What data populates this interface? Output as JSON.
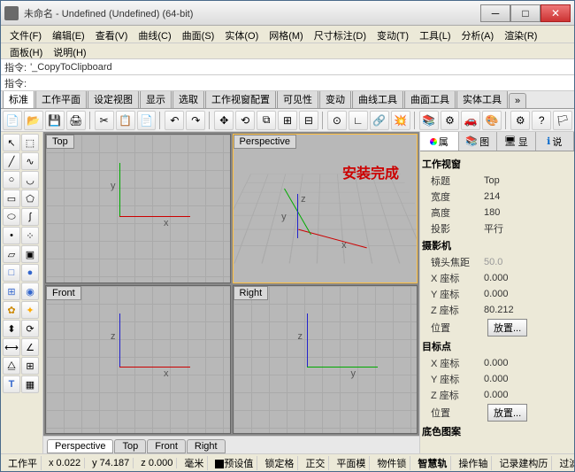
{
  "window": {
    "title": "未命名 - Undefined (Undefined) (64-bit)"
  },
  "menus": {
    "row1": [
      "文件(F)",
      "编辑(E)",
      "查看(V)",
      "曲线(C)",
      "曲面(S)",
      "实体(O)",
      "网格(M)",
      "尺寸标注(D)",
      "变动(T)",
      "工具(L)",
      "分析(A)",
      "渲染(R)"
    ],
    "row2": [
      "面板(H)",
      "说明(H)"
    ]
  },
  "command": {
    "label": "指令:",
    "prev": "'_CopyToClipboard",
    "prompt": "指令:"
  },
  "tabs": [
    "标准",
    "工作平面",
    "设定视图",
    "显示",
    "选取",
    "工作视窗配置",
    "可见性",
    "变动",
    "曲线工具",
    "曲面工具",
    "实体工具",
    "»"
  ],
  "viewports": {
    "tl": "Top",
    "tr": "Perspective",
    "bl": "Front",
    "br": "Right",
    "overlay": "安装完成"
  },
  "vptabs": [
    "Perspective",
    "Top",
    "Front",
    "Right"
  ],
  "right": {
    "tabs": [
      "属",
      "图",
      "显",
      "说"
    ],
    "g1": {
      "title": "工作视窗",
      "rows": [
        [
          "标题",
          "Top"
        ],
        [
          "宽度",
          "214"
        ],
        [
          "高度",
          "180"
        ],
        [
          "投影",
          "平行"
        ]
      ]
    },
    "g2": {
      "title": "摄影机",
      "focal": [
        "镜头焦距",
        "50.0"
      ],
      "rows": [
        [
          "X 座标",
          "0.000"
        ],
        [
          "Y 座标",
          "0.000"
        ],
        [
          "Z 座标",
          "80.212"
        ]
      ],
      "pos": "位置",
      "btn": "放置..."
    },
    "g3": {
      "title": "目标点",
      "rows": [
        [
          "X 座标",
          "0.000"
        ],
        [
          "Y 座标",
          "0.000"
        ],
        [
          "Z 座标",
          "0.000"
        ]
      ],
      "pos": "位置",
      "btn": "放置..."
    },
    "g4": {
      "title": "底色图案"
    }
  },
  "status": {
    "items": [
      "工作平",
      "x 0.022",
      "y 74.187",
      "z 0.000",
      "毫米",
      "预设值",
      "锁定格",
      "正交",
      "平面模",
      "物件锁",
      "智慧轨",
      "操作轴",
      "记录建构历",
      "过滤"
    ]
  }
}
